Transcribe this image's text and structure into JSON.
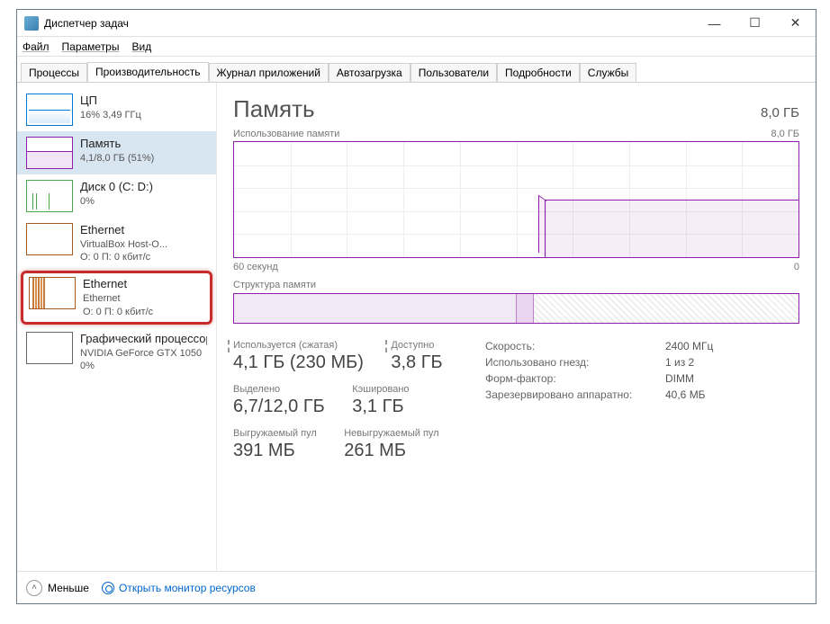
{
  "window": {
    "title": "Диспетчер задач"
  },
  "menu": {
    "file": "Файл",
    "options": "Параметры",
    "view": "Вид"
  },
  "tabs": {
    "processes": "Процессы",
    "performance": "Производительность",
    "apphistory": "Журнал приложений",
    "startup": "Автозагрузка",
    "users": "Пользователи",
    "details": "Подробности",
    "services": "Службы"
  },
  "sidebar": {
    "cpu": {
      "title": "ЦП",
      "sub": "16% 3,49 ГГц"
    },
    "mem": {
      "title": "Память",
      "sub": "4,1/8,0 ГБ (51%)"
    },
    "disk": {
      "title": "Диск 0 (C: D:)",
      "sub": "0%"
    },
    "net1": {
      "title": "Ethernet",
      "sub1": "VirtualBox Host-O...",
      "sub2": "О: 0 П: 0 кбит/с"
    },
    "net2": {
      "title": "Ethernet",
      "sub1": "Ethernet",
      "sub2": "О: 0 П: 0 кбит/с"
    },
    "gpu": {
      "title": "Графический процессор",
      "sub1": "NVIDIA GeForce GTX 1050",
      "sub2": "0%"
    }
  },
  "main": {
    "heading": "Память",
    "total": "8,0 ГБ",
    "usage_label": "Использование памяти",
    "usage_max": "8,0 ГБ",
    "axis_left": "60 секунд",
    "axis_right": "0",
    "struct_label": "Структура памяти",
    "stats": {
      "used_label": "Используется (сжатая)",
      "used_value": "4,1 ГБ (230 МБ)",
      "avail_label": "Доступно",
      "avail_value": "3,8 ГБ",
      "commit_label": "Выделено",
      "commit_value": "6,7/12,0 ГБ",
      "cached_label": "Кэшировано",
      "cached_value": "3,1 ГБ",
      "paged_label": "Выгружаемый пул",
      "paged_value": "391 МБ",
      "nonpaged_label": "Невыгружаемый пул",
      "nonpaged_value": "261 МБ"
    },
    "info": {
      "speed_k": "Скорость:",
      "speed_v": "2400 МГц",
      "slots_k": "Использовано гнезд:",
      "slots_v": "1 из 2",
      "form_k": "Форм-фактор:",
      "form_v": "DIMM",
      "hwres_k": "Зарезервировано аппаратно:",
      "hwres_v": "40,6 МБ"
    }
  },
  "footer": {
    "less": "Меньше",
    "monitor": "Открыть монитор ресурсов"
  },
  "chart_data": {
    "type": "area",
    "title": "Использование памяти",
    "ylabel": "ГБ",
    "ylim": [
      0,
      8.0
    ],
    "xlim_seconds": [
      60,
      0
    ],
    "series": [
      {
        "name": "Память",
        "x": [
          60,
          50,
          40,
          35,
          34,
          33,
          32,
          20,
          10,
          0
        ],
        "y": [
          0,
          0,
          0,
          0,
          3.6,
          4.0,
          4.1,
          4.1,
          4.1,
          4.1
        ]
      }
    ]
  }
}
